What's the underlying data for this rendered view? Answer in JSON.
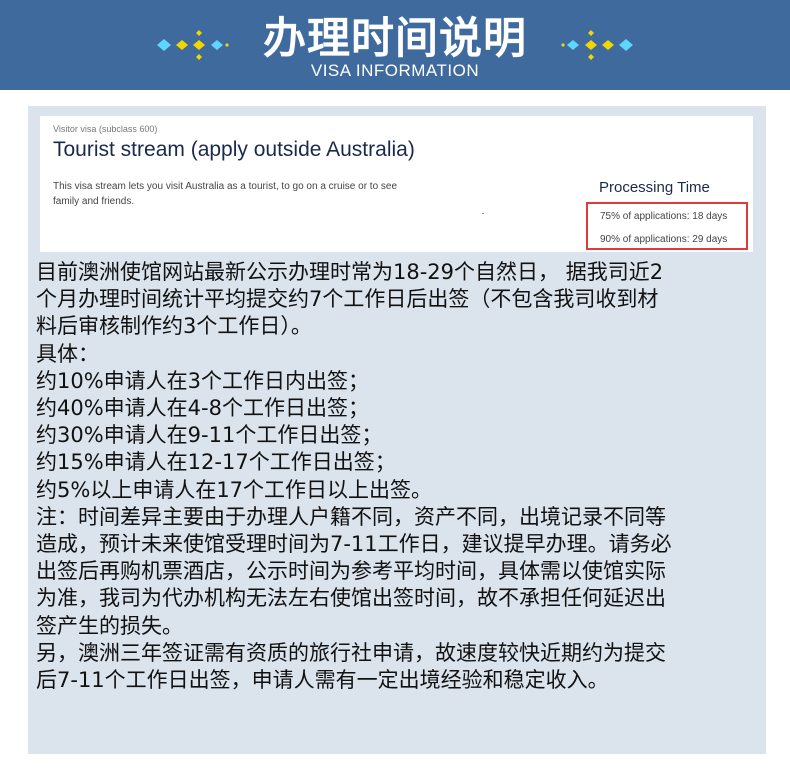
{
  "header": {
    "title": "办理时间说明",
    "subtitle": "VISA INFORMATION"
  },
  "card": {
    "visa_type": "Visitor visa (subclass 600)",
    "stream_title": "Tourist stream (apply outside Australia)",
    "description": "This visa stream lets you visit Australia as a tourist, to go on a cruise or to see family and friends.",
    "processing_title": "Processing Time",
    "processing_75": "75% of applications: 18 days",
    "processing_90": "90% of applications: 29 days"
  },
  "body": {
    "lines": [
      "目前澳洲使馆网站最新公示办理时常为18-29个自然日， 据我司近2",
      "个月办理时间统计平均提交约7个工作日后出签（不包含我司收到材",
      "料后审核制作约3个工作日）。",
      "具体：",
      "约10%申请人在3个工作日内出签；",
      "约40%申请人在4-8个工作日出签；",
      "约30%申请人在9-11个工作日出签；",
      "约15%申请人在12-17个工作日出签；",
      "约5%以上申请人在17个工作日以上出签。",
      "注：时间差异主要由于办理人户籍不同，资产不同，出境记录不同等",
      "造成，预计未来使馆受理时间为7-11工作日，建议提早办理。请务必",
      "出签后再购机票酒店，公示时间为参考平均时间，具体需以使馆实际",
      "为准，我司为代办机构无法左右使馆出签时间，故不承担任何延迟出",
      "签产生的损失。",
      "另，澳洲三年签证需有资质的旅行社申请，故速度较快近期约为提交",
      "后7-11个工作日出签，申请人需有一定出境经验和稳定收入。"
    ]
  },
  "colors": {
    "header_bg": "#3f6a9d",
    "panel_bg": "#dbe3ec",
    "highlight_border": "#e03a3a",
    "decoration_yellow": "#f2d600",
    "decoration_cyan": "#5fd6ff"
  }
}
